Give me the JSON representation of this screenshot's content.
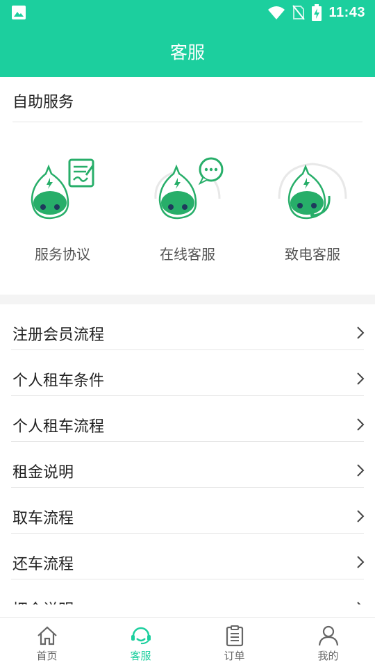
{
  "status_bar": {
    "time": "11:43",
    "icons": [
      "gallery-icon",
      "wifi-icon",
      "no-sim-icon",
      "battery-charging-icon"
    ]
  },
  "app_bar": {
    "title": "客服"
  },
  "self_service": {
    "heading": "自助服务",
    "items": [
      {
        "label": "服务协议",
        "icon": "agreement-icon"
      },
      {
        "label": "在线客服",
        "icon": "chat-icon"
      },
      {
        "label": "致电客服",
        "icon": "headset-icon"
      }
    ]
  },
  "menu": {
    "items": [
      {
        "label": "注册会员流程"
      },
      {
        "label": "个人租车条件"
      },
      {
        "label": "个人租车流程"
      },
      {
        "label": "租金说明"
      },
      {
        "label": "取车流程"
      },
      {
        "label": "还车流程"
      },
      {
        "label": "押金说明"
      }
    ]
  },
  "bottom_nav": {
    "items": [
      {
        "label": "首页",
        "icon": "home-icon"
      },
      {
        "label": "客服",
        "icon": "customer-service-icon",
        "active": true
      },
      {
        "label": "订单",
        "icon": "clipboard-icon"
      },
      {
        "label": "我的",
        "icon": "person-icon"
      }
    ]
  },
  "colors": {
    "primary": "#1ccf9e",
    "mascot": "#27ae69",
    "text": "#222222",
    "divider": "#e6e6e6"
  }
}
